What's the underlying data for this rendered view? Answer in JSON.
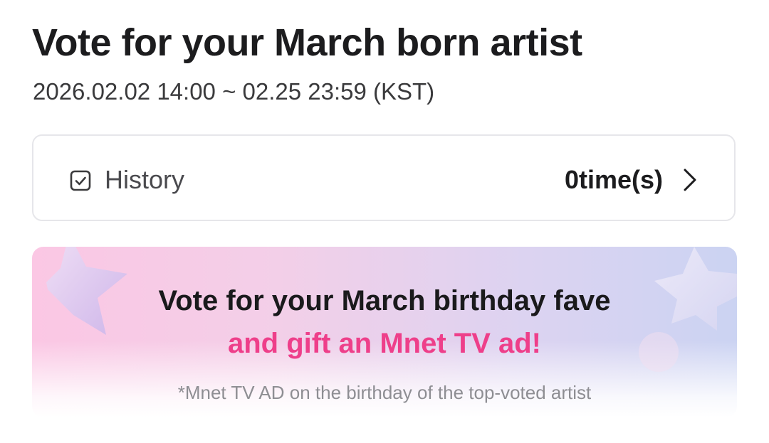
{
  "header": {
    "title": "Vote for your March born artist",
    "period": "2026.02.02 14:00 ~ 02.25 23:59 (KST)"
  },
  "history": {
    "label": "History",
    "count": "0time(s)",
    "icon": "checkbox-icon",
    "chevron": "chevron-right-icon"
  },
  "banner": {
    "line1": "Vote for your March birthday fave",
    "line2": "and gift an Mnet TV ad!",
    "note": "*Mnet TV AD on the birthday of the top-voted artist",
    "colors": {
      "highlight": "#ee3f8a",
      "gradient_start": "#fbc7e4",
      "gradient_end": "#cbd3f2"
    },
    "decor_icons": [
      "star-icon",
      "star-icon"
    ]
  }
}
